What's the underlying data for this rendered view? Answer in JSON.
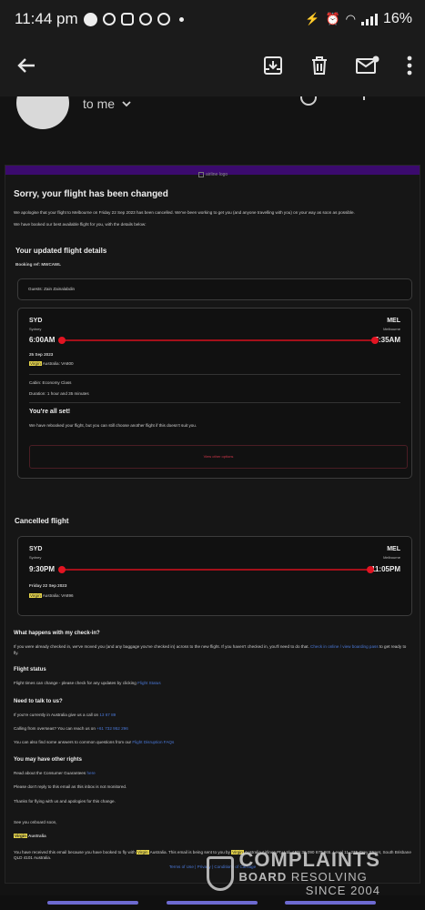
{
  "status_bar": {
    "time": "11:44 pm",
    "battery": "16%"
  },
  "sender": {
    "recipient": "to me"
  },
  "email": {
    "logo_alt": "airline logo",
    "title": "Sorry, your flight has been changed",
    "intro": "We apologise that your flight to Melbourne on Friday 22 Sep 2023 has been cancelled. We've been working to get you (and anyone travelling with you) on your way as soon as possible.",
    "intro2": "We have booked our best available flight for you, with the details below:",
    "updated_heading": "Your updated flight details",
    "booking_ref": "Booking ref: MWCAWL",
    "guests": "Guests: Zain Zainalabdin",
    "updated_flight": {
      "from_code": "SYD",
      "from_city": "Sydney",
      "to_code": "MEL",
      "to_city": "Melbourne",
      "depart": "6:00AM",
      "arrive": "7:35AM",
      "date": "25 Sep 2023",
      "airline_hl": "Virgin",
      "airline_rest": " Australia: VA800",
      "cabin": "Cabin: Economy Class",
      "duration": "Duration: 1 hour and 35 minutes",
      "all_set": "You're all set!",
      "all_set_text": "We have rebooked your flight, but you can still choose another flight if this doesn't suit you.",
      "button": "View other options"
    },
    "cancelled_heading": "Cancelled flight",
    "cancelled_flight": {
      "from_code": "SYD",
      "from_city": "Sydney",
      "to_code": "MEL",
      "to_city": "Melbourne",
      "depart": "9:30PM",
      "arrive": "11:05PM",
      "date": "Friday 22 Sep 2023",
      "airline_hl": "Virgin",
      "airline_rest": " Australia: VA896"
    },
    "checkin_heading": "What happens with my check-in?",
    "checkin_text": "If you were already checked in, we've moved you (and any baggage you've checked in) across to the new flight. If you haven't checked in, you'll need to do that.",
    "checkin_link": "Check in online / view boarding pass",
    "checkin_tail": " to get ready to fly.",
    "status_heading": "Flight status",
    "status_text": "Flight times can change - please check for any updates by clicking",
    "status_link": "Flight Status",
    "talk_heading": "Need to talk to us?",
    "talk_aus": "If you're currently in Australia give us a call on",
    "talk_aus_num": "13 67 89",
    "talk_overseas": "Calling from overseas? You can reach us on",
    "talk_overseas_num": "+61 732 952 296",
    "talk_faq": "You can also find some answers to common questions from our",
    "talk_faq_link": "Flight Disruption FAQs",
    "rights_heading": "You may have other rights",
    "rights_text": "Read about the Consumer Guarantees",
    "rights_link": "here",
    "noreply": "Please don't reply to this email as this inbox is not monitored.",
    "thanks": "Thanks for flying with us and apologies for this change.",
    "see_you": "See you onboard soon,",
    "sign_hl": "Virgin",
    "sign_rest": " Australia",
    "footer1_a": "You have received this email because you have booked to fly with",
    "footer1_hl": "Virgin",
    "footer1_b": " Australia. This email is being sent to you by",
    "footer1_hl2": "Virgin",
    "footer1_c": " Australia Airlines Pty Ltd, ABN 36 090 670 965, Level 11, 275 Grey Street, South Brisbane QLD 4101 Australia.",
    "footer2": "Terms of Use | Privacy | Conditions of Carriage"
  },
  "watermark": {
    "line1": "COMPLAINTS",
    "line2_bold": "BOARD",
    "line2_rest": " RESOLVING",
    "line3": "SINCE 2004"
  },
  "colors": {
    "accent": "#e21422",
    "band": "#3b0a6e",
    "link": "#4a78d8",
    "highlight": "#e3d24a"
  }
}
